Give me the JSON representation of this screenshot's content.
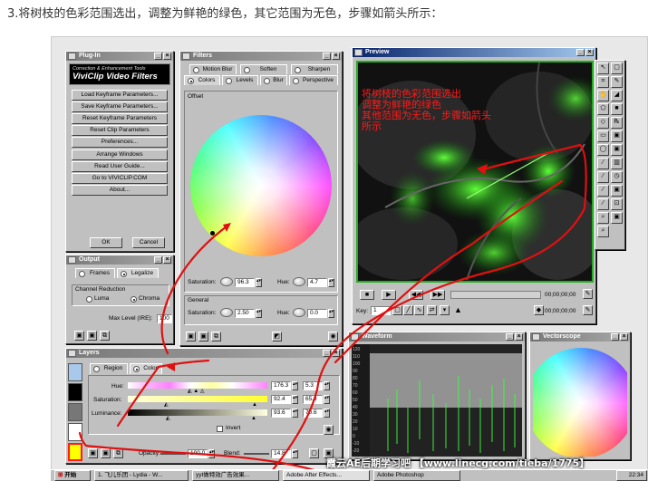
{
  "step_text": "3.将树枝的色彩范围选出，调整为鲜艳的绿色，其它范围为无色，步骤如箭头所示：",
  "plugin_window": {
    "title": "Plug-In",
    "logo_line1": "Correction & Enhancement Tools",
    "logo_line2": "ViviClip Video Filters",
    "buttons": [
      "Load Keyframe Parameters...",
      "Save Keyframe Parameters...",
      "Reset Keyframe Parameters",
      "Reset Clip Parameters",
      "Preferences...",
      "Arrange Windows",
      "Read User Guide...",
      "Go to VIVICLIP.COM",
      "About..."
    ],
    "ok_label": "OK",
    "cancel_label": "Cancel"
  },
  "filters_window": {
    "title": "Filters",
    "tabs_row1": [
      "Motion Blur",
      "Soften",
      "Sharpen"
    ],
    "tabs_row2": [
      "Colors",
      "Levels",
      "Blur",
      "Perspective"
    ],
    "offset_label": "Offset",
    "saturation_label": "Saturation:",
    "saturation_value": "96.3",
    "hue_label": "Hue:",
    "hue_value": "4.7",
    "general_label": "General",
    "general_saturation_label": "Saturation:",
    "general_saturation_value": "2.50",
    "general_hue_label": "Hue:",
    "general_hue_value": "0.0"
  },
  "output_window": {
    "title": "Output",
    "tab_frames": "Frames",
    "tab_legalize": "Legalize",
    "channel_reduction_label": "Channel Reduction",
    "option_luma": "Luma",
    "option_chroma": "Chroma",
    "max_level_label": "Max Level (IRE):",
    "max_level_value": "100"
  },
  "layers_window": {
    "title": "Layers",
    "option_region": "Region",
    "option_color": "Color",
    "hue_label": "Hue:",
    "hue_value1": "176.3",
    "hue_value2": "5.3",
    "saturation_label": "Saturation:",
    "saturation_value1": "92.4",
    "saturation_value2": "65.3",
    "luminance_label": "Luminance:",
    "luminance_value1": "93.6",
    "luminance_value2": "70.6",
    "invert_label": "Invert",
    "opacity_label": "Opacity:",
    "opacity_value": "100.0",
    "blend_label": "Blend:",
    "blend_value": "14.8"
  },
  "preview_window": {
    "title": "Preview",
    "timecode1": "00;00;00;00",
    "timecode2": "00;00;00;00",
    "key_label": "Key:",
    "key_value": "1"
  },
  "annotation": {
    "lines": [
      "将树枝的色彩范围选出",
      "调整为鲜艳的绿色",
      "其他范围为无色，步骤如箭头",
      "所示"
    ],
    "color": "#ff1a1a"
  },
  "waveform_window": {
    "title": "Waveform",
    "scale": [
      "120",
      "110",
      "100",
      "90",
      "80",
      "70",
      "60",
      "50",
      "40",
      "30",
      "20",
      "10",
      "0",
      "-10",
      "-20"
    ]
  },
  "vectorscope_window": {
    "title": "Vectorscope"
  },
  "watermark": "霞云AE后期学习吧 【www.linecg.com/tieba/1775】",
  "taskbar": {
    "start_label": "开始",
    "tasks": [
      "1. 飞儿乐团 - Lydia - W...",
      "yyt做特效广告效果...",
      "Adobe After Effects...",
      "Adobe Photoshop"
    ],
    "clock": "22:34"
  }
}
